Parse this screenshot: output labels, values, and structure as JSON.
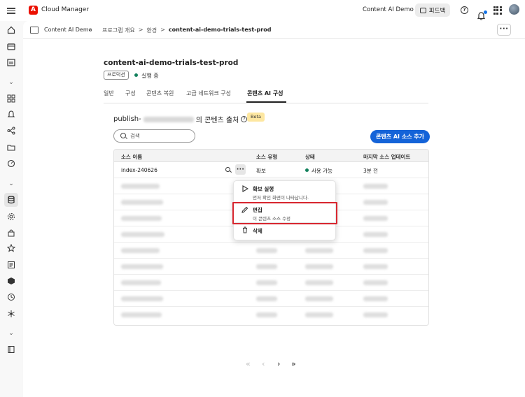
{
  "app": {
    "brand": "Cloud Manager",
    "org": "Content AI Demo",
    "feedback_label": "피드백"
  },
  "topbar": {
    "icons": [
      "menu-icon",
      "help-icon",
      "notification-icon",
      "apps-icon",
      "avatar"
    ]
  },
  "sidebar": {
    "icons": [
      "home-icon",
      "programs-icon",
      "activity-icon",
      "chevron-down-icon",
      "overview-icon",
      "alerts-icon",
      "pipelines-icon",
      "folder-icon",
      "dashboard-icon",
      "chevron-down-icon",
      "database-icon",
      "settings-icon",
      "lock-icon",
      "star-icon",
      "report-icon",
      "box-icon",
      "history-icon",
      "network-icon",
      "chevron-down-icon",
      "book-icon"
    ]
  },
  "breadcrumb": {
    "program": "Content AI Demo",
    "items": [
      "프로그램 개요",
      "환경",
      "content-ai-demo-trials-test-prod"
    ],
    "separators": [
      ">",
      ">"
    ]
  },
  "page": {
    "title": "content-ai-demo-trials-test-prod",
    "env_badge": "프로덕션",
    "status": "실행 중"
  },
  "tabs": [
    "일반",
    "구성",
    "콘텐츠 복원",
    "고급 네트워크 구성",
    "콘텐츠 AI 구성"
  ],
  "section": {
    "prefix": "publish-",
    "suffix": "의 콘텐츠 출처",
    "info": "?",
    "badge": "Beta"
  },
  "search": {
    "placeholder": "검색",
    "value": ""
  },
  "add_button": "콘텐츠 AI 소스 추가",
  "table": {
    "columns": [
      "소스 이름",
      "소스 유형",
      "상태",
      "마지막 소스 업데이트"
    ],
    "first_row": {
      "name": "index-240626",
      "type": "확보",
      "status": "사용 가능",
      "updated": "3분 전",
      "more": "···"
    }
  },
  "context_menu": {
    "items": [
      {
        "icon": "play-icon",
        "label": "확보 실행",
        "desc": "먼저 확인 화면이 나타납니다."
      },
      {
        "icon": "edit-icon",
        "label": "편집",
        "desc": "이 콘텐츠 소스 수정"
      },
      {
        "icon": "delete-icon",
        "label": "삭제",
        "desc": ""
      }
    ]
  },
  "pagination": {
    "first": "«",
    "prev": "‹",
    "next": "›",
    "last": "»"
  },
  "colors": {
    "accent": "#1463d8",
    "status_green": "#12805c",
    "highlight_red": "#d7262f",
    "beta_bg": "#fde7a1",
    "logo_red": "#eb1000"
  }
}
